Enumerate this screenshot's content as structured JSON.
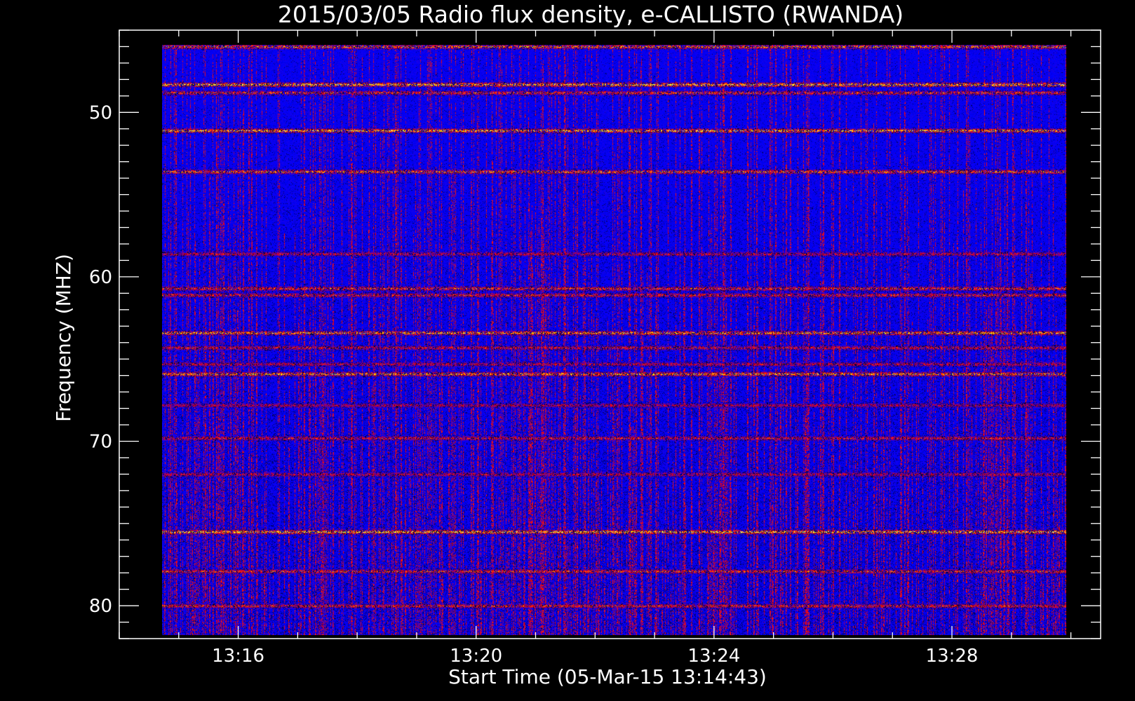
{
  "chart_data": {
    "type": "heatmap",
    "title": "2015/03/05  Radio flux density, e-CALLISTO (RWANDA)",
    "xlabel": "Start Time (05-Mar-15 13:14:43)",
    "ylabel": "Frequency (MHZ)",
    "x": {
      "unit": "time",
      "start": "13:14:43",
      "range_minutes": [
        14.0,
        30.5
      ],
      "data_range_minutes": [
        14.72,
        29.92
      ],
      "major_ticks": [
        {
          "minute": 16,
          "label": "13:16"
        },
        {
          "minute": 20,
          "label": "13:20"
        },
        {
          "minute": 24,
          "label": "13:24"
        },
        {
          "minute": 28,
          "label": "13:28"
        }
      ],
      "minor_step_minutes": 1
    },
    "y": {
      "unit": "MHz",
      "range": [
        45.0,
        82.0
      ],
      "data_range": [
        45.9,
        81.8
      ],
      "inverted": true,
      "major_ticks": [
        {
          "value": 50,
          "label": "50"
        },
        {
          "value": 60,
          "label": "60"
        },
        {
          "value": 70,
          "label": "70"
        },
        {
          "value": 80,
          "label": "80"
        }
      ],
      "minor_step": 1
    },
    "colormap": [
      "#000000",
      "#0000ff",
      "#ff0000",
      "#ffff00",
      "#ffffff"
    ],
    "background_color": "#0000ff",
    "interference_bands_mhz": [
      {
        "freq": 46.0,
        "intensity": 0.75
      },
      {
        "freq": 48.3,
        "intensity": 0.9
      },
      {
        "freq": 48.8,
        "intensity": 0.6
      },
      {
        "freq": 51.1,
        "intensity": 0.85
      },
      {
        "freq": 53.6,
        "intensity": 0.7
      },
      {
        "freq": 58.6,
        "intensity": 0.45
      },
      {
        "freq": 60.7,
        "intensity": 0.6
      },
      {
        "freq": 61.1,
        "intensity": 0.55
      },
      {
        "freq": 63.4,
        "intensity": 0.8
      },
      {
        "freq": 64.3,
        "intensity": 0.5
      },
      {
        "freq": 65.3,
        "intensity": 0.45
      },
      {
        "freq": 65.9,
        "intensity": 0.8
      },
      {
        "freq": 67.8,
        "intensity": 0.4
      },
      {
        "freq": 69.8,
        "intensity": 0.5
      },
      {
        "freq": 72.0,
        "intensity": 0.45
      },
      {
        "freq": 75.5,
        "intensity": 0.9
      },
      {
        "freq": 77.9,
        "intensity": 0.6
      },
      {
        "freq": 80.0,
        "intensity": 0.55
      }
    ],
    "grid": false,
    "legend": "none"
  }
}
